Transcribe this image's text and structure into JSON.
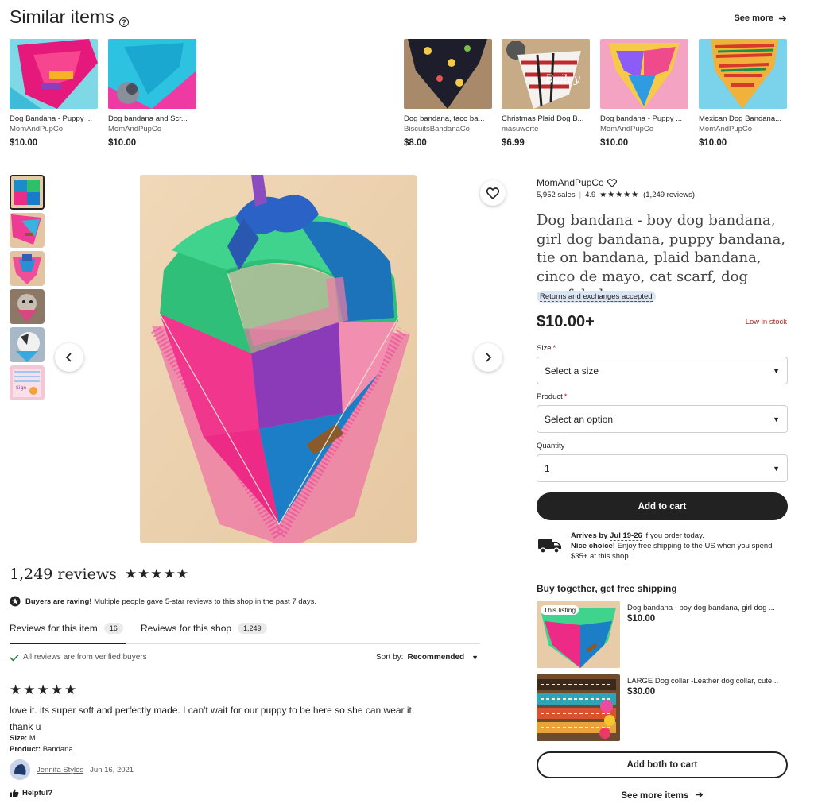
{
  "similar": {
    "title": "Similar items",
    "see_more": "See more",
    "items": [
      {
        "title": "Dog Bandana - Puppy ...",
        "shop": "MomAndPupCo",
        "price": "$10.00"
      },
      {
        "title": "Dog bandana and Scr...",
        "shop": "MomAndPupCo",
        "price": "$10.00"
      },
      {
        "title": "Dog bandana, taco ba...",
        "shop": "BiscuitsBandanaCo",
        "price": "$8.00"
      },
      {
        "title": "Christmas Plaid Dog B...",
        "shop": "masuwerte",
        "price": "$6.99"
      },
      {
        "title": "Dog bandana - Puppy ...",
        "shop": "MomAndPupCo",
        "price": "$10.00"
      },
      {
        "title": "Mexican Dog Bandana...",
        "shop": "MomAndPupCo",
        "price": "$10.00"
      }
    ]
  },
  "listing": {
    "shop_name": "MomAndPupCo",
    "sales": "5,952 sales",
    "rating": "4.9",
    "rating_stars": "★★★★★",
    "reviews_paren": "(1,249 reviews)",
    "title": "Dog bandana - boy dog bandana, girl dog bandana, puppy bandana, tie on bandana, plaid bandana, cinco de mayo, cat scarf, dog scarf, boho",
    "returns_badge": "Returns and exchanges accepted",
    "price": "$10.00+",
    "low_stock": "Low in stock",
    "size_label": "Size",
    "size_value": "Select a size",
    "product_label": "Product",
    "product_value": "Select an option",
    "quantity_label": "Quantity",
    "quantity_value": "1",
    "required_mark": "*",
    "add_to_cart": "Add to cart"
  },
  "shipping": {
    "arrives_prefix": "Arrives by",
    "arrives_date": "Jul 19-26",
    "arrives_suffix": "if you order today.",
    "nice_choice": "Nice choice!",
    "free_shipping": "Enjoy free shipping to the US when you spend $35+ at this shop."
  },
  "buy_together": {
    "title": "Buy together, get free shipping",
    "this_listing": "This listing",
    "items": [
      {
        "title": "Dog bandana - boy dog bandana, girl dog ...",
        "price": "$10.00"
      },
      {
        "title": "LARGE Dog collar -Leather dog collar, cute...",
        "price": "$30.00"
      }
    ],
    "add_both": "Add both to cart",
    "see_more": "See more items"
  },
  "reviews": {
    "count_title": "1,249 reviews",
    "stars": "★★★★★",
    "raving_bold": "Buyers are raving!",
    "raving_text": "Multiple people gave 5-star reviews to this shop in the past 7 days.",
    "tab_item": "Reviews for this item",
    "tab_item_count": "16",
    "tab_shop": "Reviews for this shop",
    "tab_shop_count": "1,249",
    "verified": "All reviews are from verified buyers",
    "sort_label": "Sort by:",
    "sort_value": "Recommended",
    "review": {
      "stars": "★★★★★",
      "text_line1": "love it. its super soft and perfectly made. I can't wait for our puppy to be here so she can wear it.",
      "text_line2": "thank u",
      "size_label": "Size:",
      "size_value": "M",
      "product_label": "Product:",
      "product_value": "Bandana",
      "reviewer": "Jennifa Styles",
      "date": "Jun 16, 2021",
      "helpful": "Helpful?"
    }
  },
  "colors": {
    "accent_dark": "#222222",
    "low_stock": "#b3261e",
    "badge_bg": "#dbe6f5"
  },
  "icons": [
    "help-icon",
    "arrow-right-icon",
    "heart-icon",
    "chevron-left-icon",
    "chevron-right-icon",
    "caret-down-icon",
    "truck-icon",
    "raving-badge-icon",
    "check-icon",
    "thumbs-up-icon"
  ]
}
